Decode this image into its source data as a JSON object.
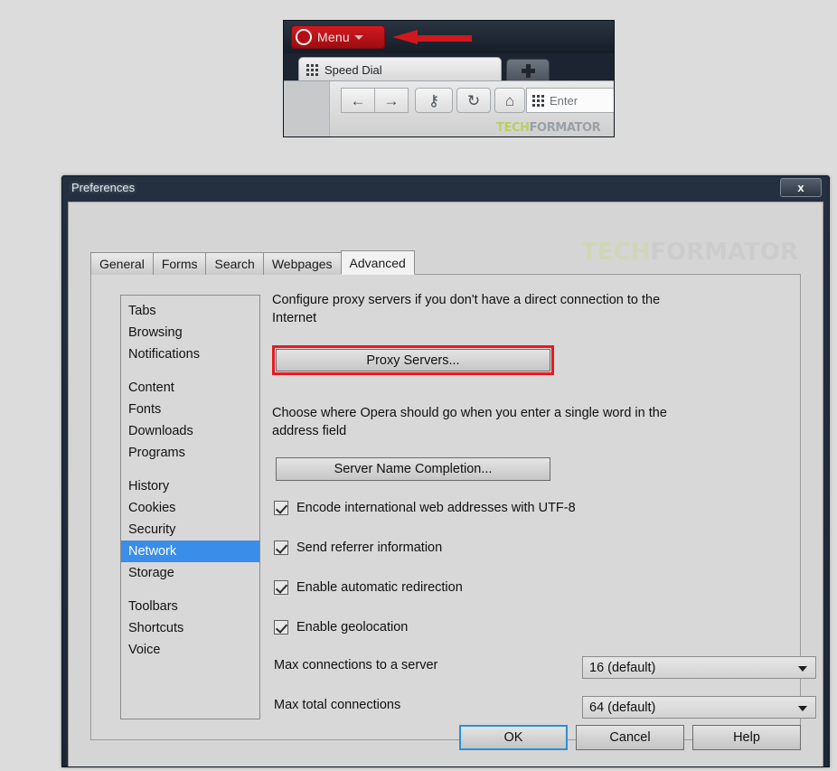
{
  "browser": {
    "menu_button": {
      "label": "Menu",
      "icon": "opera-logo-icon",
      "caret": "chevron-down-icon"
    },
    "pointer_arrow": "red-left-arrow-annotation",
    "tab": {
      "label": "Speed Dial",
      "icon": "speed-dial-grid-icon"
    },
    "new_tab_label": "+",
    "toolbar": {
      "back": "←",
      "forward": "→",
      "key": "⚷",
      "reload": "↻",
      "home": "⌂",
      "address_placeholder": "Enter"
    },
    "watermark": {
      "part1": "TECH",
      "part2": "FORMATOR"
    }
  },
  "dialog": {
    "title": "Preferences",
    "close_label": "x",
    "watermark": {
      "part1": "TECH",
      "part2": "FORMATOR"
    },
    "tabs": [
      {
        "label": "General",
        "active": false
      },
      {
        "label": "Forms",
        "active": false
      },
      {
        "label": "Search",
        "active": false
      },
      {
        "label": "Webpages",
        "active": false
      },
      {
        "label": "Advanced",
        "active": true
      }
    ],
    "sidebar": {
      "groups": [
        {
          "items": [
            {
              "label": "Tabs"
            },
            {
              "label": "Browsing"
            },
            {
              "label": "Notifications"
            }
          ]
        },
        {
          "items": [
            {
              "label": "Content"
            },
            {
              "label": "Fonts"
            },
            {
              "label": "Downloads"
            },
            {
              "label": "Programs"
            }
          ]
        },
        {
          "items": [
            {
              "label": "History"
            },
            {
              "label": "Cookies"
            },
            {
              "label": "Security"
            },
            {
              "label": "Network"
            },
            {
              "label": "Storage"
            }
          ]
        },
        {
          "items": [
            {
              "label": "Toolbars"
            },
            {
              "label": "Shortcuts"
            },
            {
              "label": "Voice"
            }
          ]
        }
      ],
      "selected": "Network",
      "selected_color": "#3a8de8"
    },
    "content": {
      "proxy_description": "Configure proxy servers if you don't have a direct connection to the Internet",
      "proxy_button": "Proxy Servers...",
      "proxy_highlight_color": "#e8191f",
      "server_completion_description": "Choose where Opera should go when you enter a single word in the address field",
      "server_completion_button": "Server Name Completion...",
      "checkboxes": [
        {
          "label": "Encode international web addresses with UTF-8",
          "checked": true
        },
        {
          "label": "Send referrer information",
          "checked": true
        },
        {
          "label": "Enable automatic redirection",
          "checked": true
        },
        {
          "label": "Enable geolocation",
          "checked": true
        }
      ],
      "selects": [
        {
          "label": "Max connections to a server",
          "value": "16 (default)"
        },
        {
          "label": "Max total connections",
          "value": "64 (default)"
        }
      ]
    },
    "buttons": {
      "ok": "OK",
      "cancel": "Cancel",
      "help": "Help",
      "default_focus_color": "#2d8fd4"
    }
  }
}
